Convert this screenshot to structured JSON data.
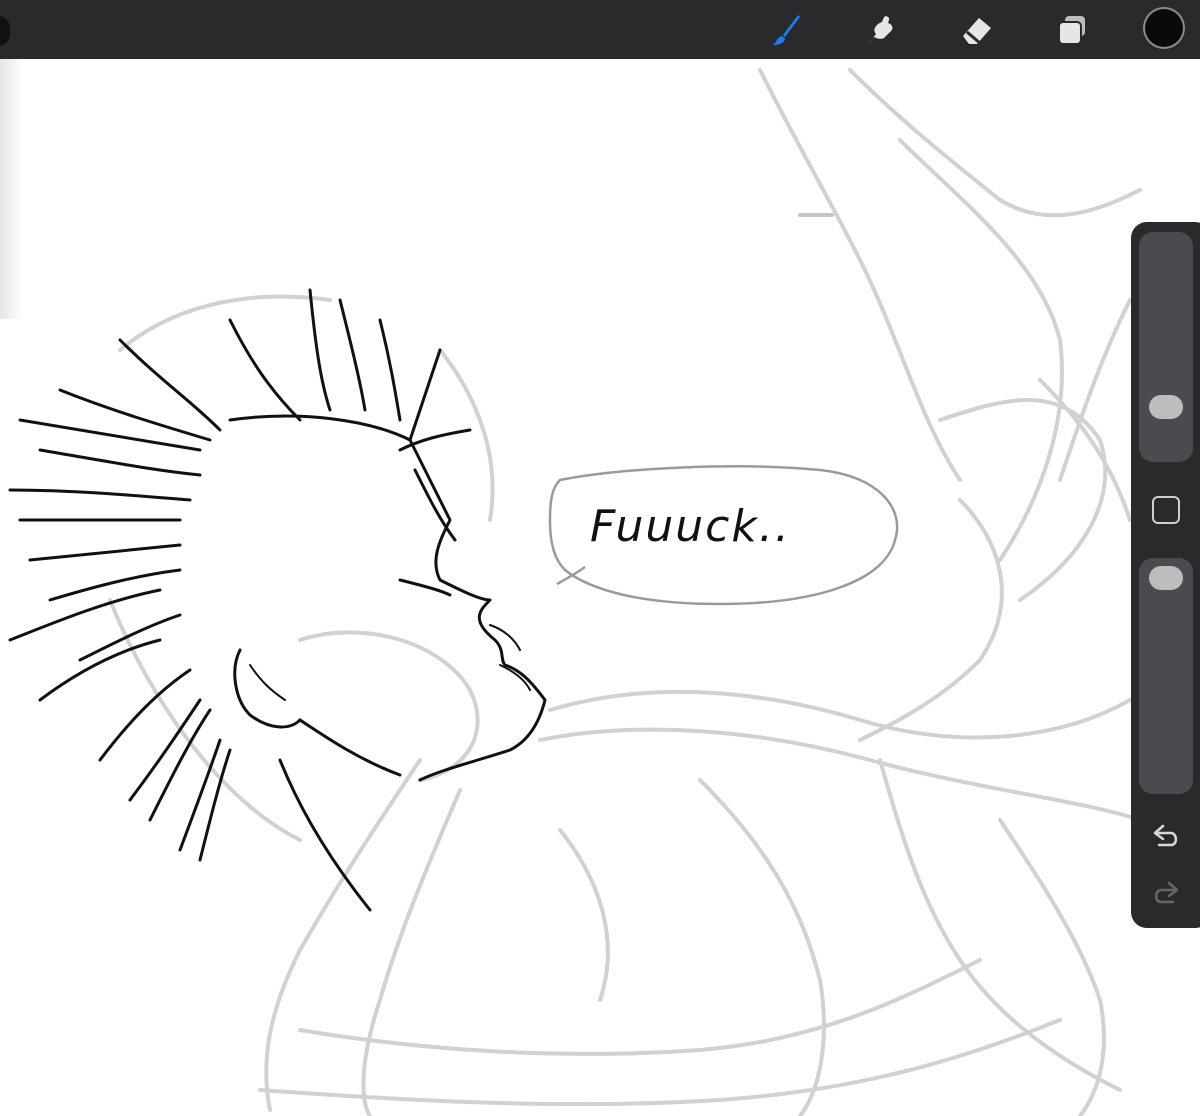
{
  "toolbar": {
    "tools": [
      {
        "name": "brush",
        "icon": "brush-icon",
        "active": true
      },
      {
        "name": "smudge",
        "icon": "smudge-icon",
        "active": false
      },
      {
        "name": "eraser",
        "icon": "eraser-icon",
        "active": false
      },
      {
        "name": "layers",
        "icon": "layers-icon",
        "active": false
      }
    ],
    "current_color": "#0a0a0a",
    "active_tool_color": "#1f7af0"
  },
  "sidebar": {
    "brush_size": 0.2,
    "opacity": 1.0,
    "undo_icon": "undo-icon",
    "redo_icon": "redo-icon",
    "modify_icon": "square-icon"
  },
  "canvas": {
    "speech_text": "Fuuuck.."
  }
}
